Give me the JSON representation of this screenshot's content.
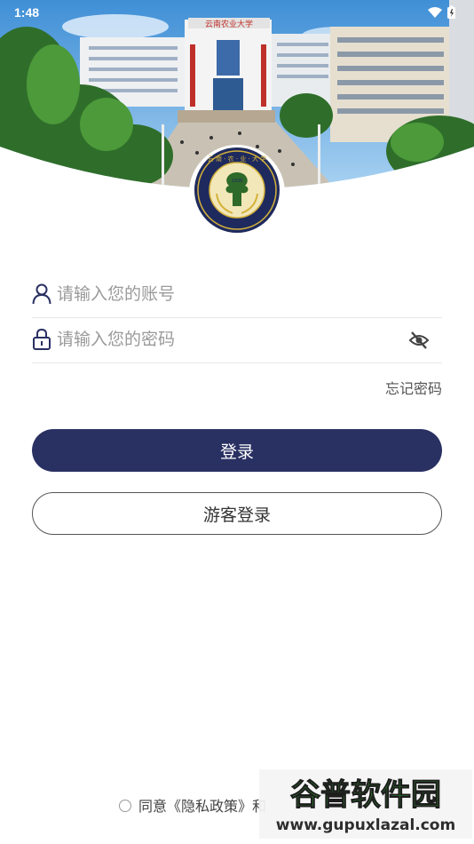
{
  "status": {
    "time": "1:48"
  },
  "login": {
    "account_placeholder": "请输入您的账号",
    "password_placeholder": "请输入您的密码",
    "forgot_label": "忘记密码",
    "login_label": "登录",
    "guest_label": "游客登录"
  },
  "agreement": {
    "prefix": "同意",
    "privacy": "《隐私政策》",
    "and": "和"
  },
  "watermark": {
    "brand": "谷普软件园",
    "url": "www.gupuxlazal.com"
  },
  "colors": {
    "primary": "#293062",
    "logo_ring": "#1e2a5e",
    "logo_gold": "#d4b13a"
  }
}
